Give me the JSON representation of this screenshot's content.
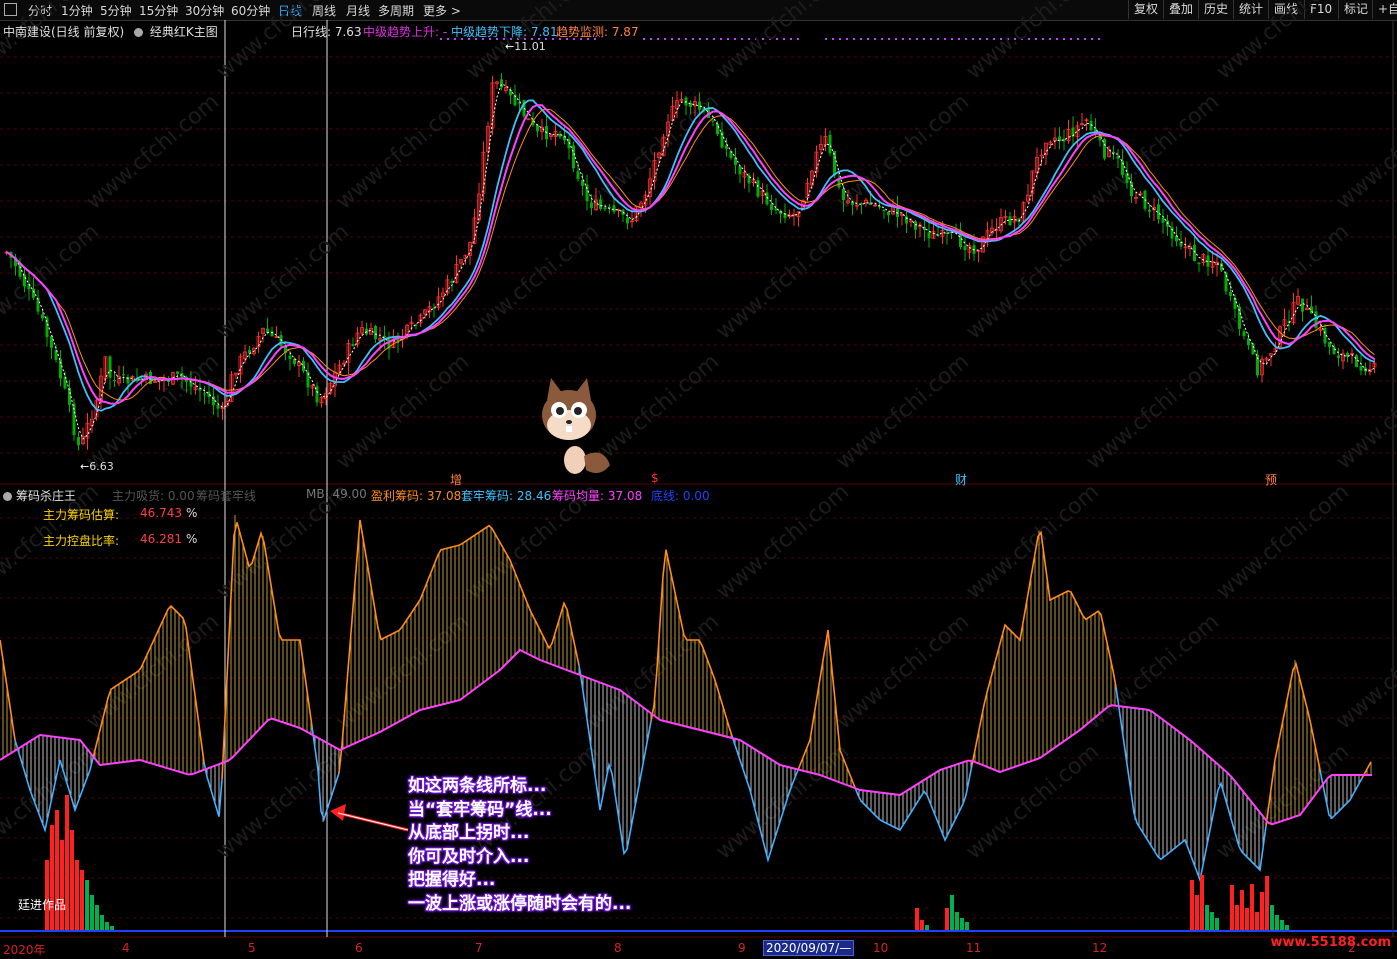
{
  "toolbar": {
    "periods": [
      "分时",
      "1分钟",
      "5分钟",
      "15分钟",
      "30分钟",
      "60分钟",
      "日线",
      "周线",
      "月线",
      "多周期",
      "更多 >"
    ],
    "active": "日线",
    "right_buttons": [
      "复权",
      "叠加",
      "历史",
      "统计",
      "画线",
      "F10",
      "标记",
      "+自选"
    ]
  },
  "main_panel": {
    "stock": "中南建设(日线 前复权)",
    "template": "经典红K主图",
    "indicators": [
      {
        "label": "日行线: 7.63",
        "color": "#e0e0e0"
      },
      {
        "label": "中级趋势上升: -",
        "color": "#e030e0"
      },
      {
        "label": "中级趋势下降: 7.81",
        "color": "#40c0ff"
      },
      {
        "label": "趋势监测: 7.87",
        "color": "#ff8040"
      }
    ],
    "high_label": "11.01",
    "low_label": "6.63",
    "markers": [
      {
        "text": "增",
        "color": "#ff8040"
      },
      {
        "text": "$",
        "color": "#ff3030"
      },
      {
        "text": "财",
        "color": "#40c0ff"
      },
      {
        "text": "预",
        "color": "#ff8040"
      }
    ]
  },
  "sub_panel": {
    "title": "筹码杀庄王",
    "indicators": [
      {
        "label": "主力吸货: 0.00",
        "color": "#555"
      },
      {
        "label": "筹码套牢线",
        "color": "#555"
      },
      {
        "label": "MB: 49.00",
        "color": "#777"
      },
      {
        "label": "盈利筹码: 37.08",
        "color": "#ff8c1a"
      },
      {
        "label": "套牢筹码: 28.46",
        "color": "#40c0ff"
      },
      {
        "label": "筹码均量: 37.08",
        "color": "#ff40ff"
      },
      {
        "label": "底线: 0.00",
        "color": "#2040ff"
      }
    ],
    "stats": [
      {
        "label": "主力筹码估算:",
        "value": "46.743",
        "unit": "%"
      },
      {
        "label": "主力控盘比率:",
        "value": "46.281",
        "unit": "%"
      }
    ],
    "author": "廷进作品"
  },
  "annotation": {
    "lines": [
      "如这两条线所标...",
      "当“套牢筹码”线...",
      "从底部上拐时...",
      "你可及时介入...",
      "把握得好...",
      "一波上涨或涨停随时会有的..."
    ]
  },
  "x_axis": {
    "labels": [
      "2020年",
      "4",
      "5",
      "6",
      "7",
      "8",
      "9",
      "10",
      "11",
      "12",
      "2"
    ],
    "selected": "2020/09/07/—"
  },
  "logo": "www.55188.com",
  "watermark": "www.cfchi.com",
  "colors": {
    "up": "#ff3030",
    "down": "#00b000",
    "ma_short": "#40c0ff",
    "ma_mid": "#ff40ff",
    "ma_long": "#ff8c1a",
    "divider": "#5a0000"
  }
}
